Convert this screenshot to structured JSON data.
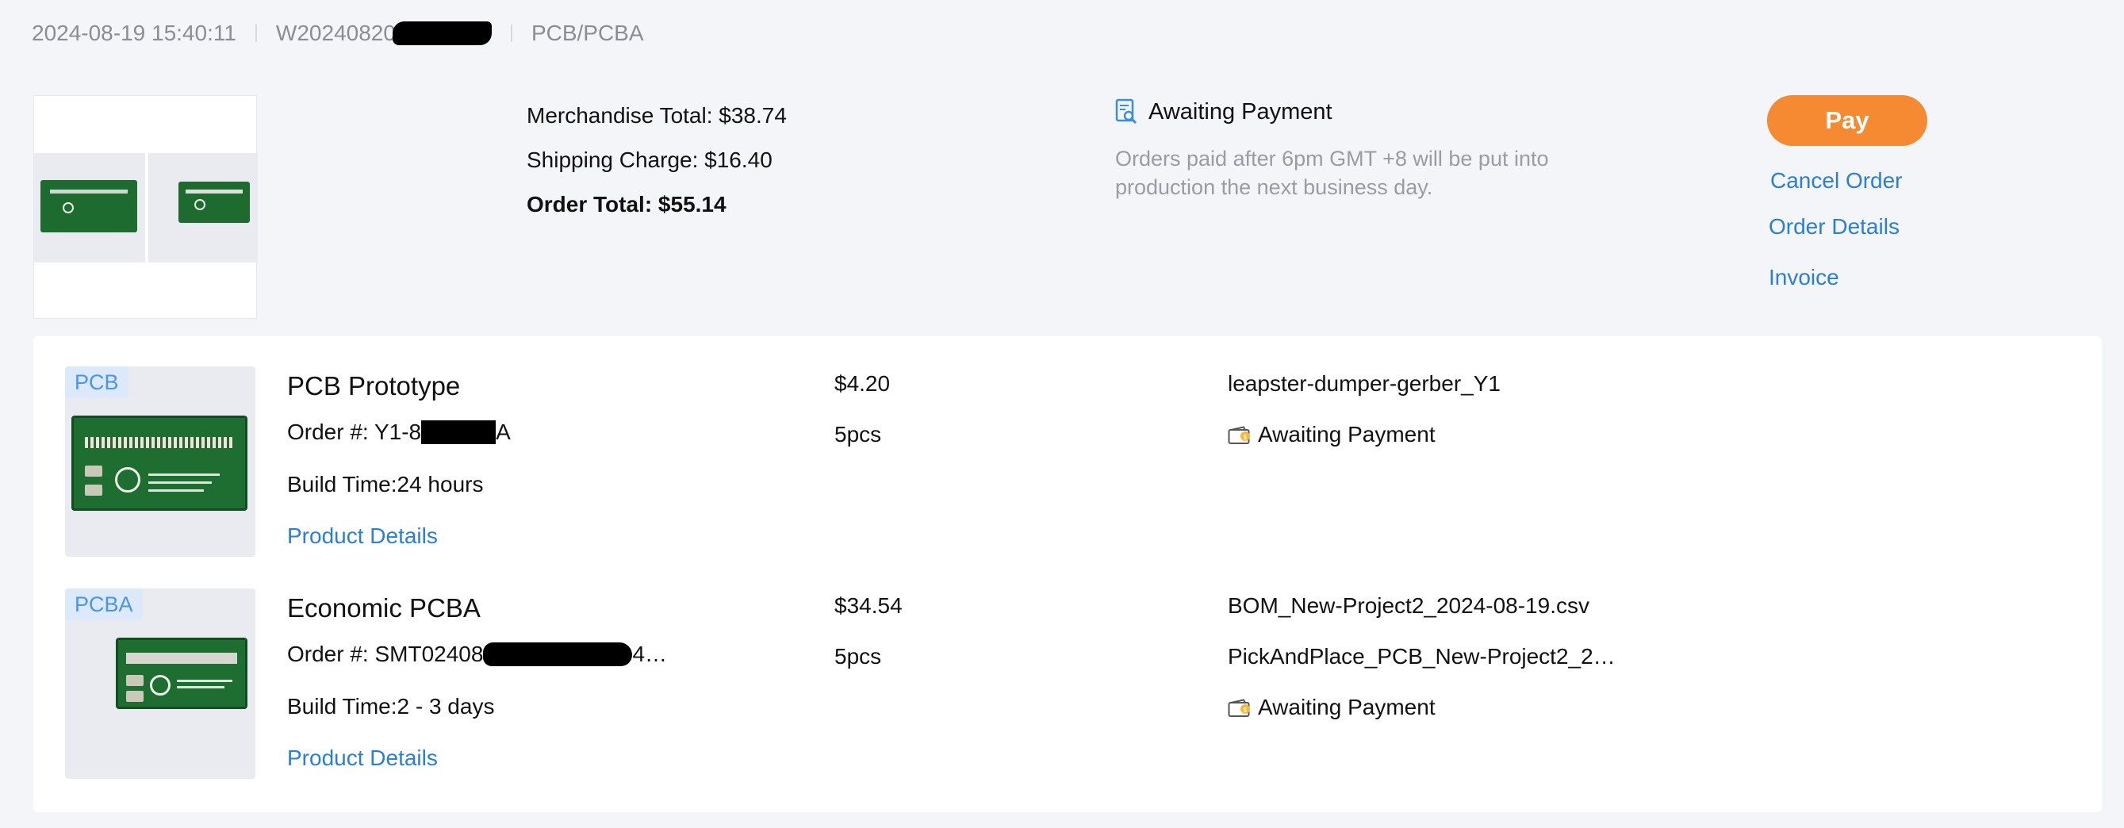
{
  "header": {
    "datetime": "2024-08-19 15:40:11",
    "order_number_prefix": "W20240820",
    "category": "PCB/PCBA"
  },
  "summary": {
    "merchandise_total": "Merchandise Total: $38.74",
    "shipping_charge": "Shipping Charge: $16.40",
    "order_total": "Order Total: $55.14",
    "status": "Awaiting Payment",
    "status_note": "Orders paid after 6pm GMT +8 will be put into production the next business day."
  },
  "actions": {
    "pay": "Pay",
    "cancel": "Cancel Order",
    "details": "Order Details",
    "invoice": "Invoice"
  },
  "items": [
    {
      "tag": "PCB",
      "title": "PCB Prototype",
      "order_prefix": "Order #: Y1-8",
      "order_suffix": "A",
      "build_time": "Build Time:24 hours",
      "link": "Product Details",
      "price": "$4.20",
      "quantity": "5pcs",
      "files": [
        "leapster-dumper-gerber_Y1"
      ],
      "status": "Awaiting Payment"
    },
    {
      "tag": "PCBA",
      "title": "Economic PCBA",
      "order_prefix": "Order #: SMT02408",
      "order_suffix": "4…",
      "build_time": "Build Time:2 - 3 days",
      "link": "Product Details",
      "price": "$34.54",
      "quantity": "5pcs",
      "files": [
        "BOM_New-Project2_2024-08-19.csv",
        "PickAndPlace_PCB_New-Project2_2…"
      ],
      "status": "Awaiting Payment"
    }
  ],
  "colors": {
    "accent_orange": "#f68a32",
    "link_blue": "#2a7fd0",
    "tag_bg": "#dbe9fb",
    "board_green": "#1f6e31"
  }
}
